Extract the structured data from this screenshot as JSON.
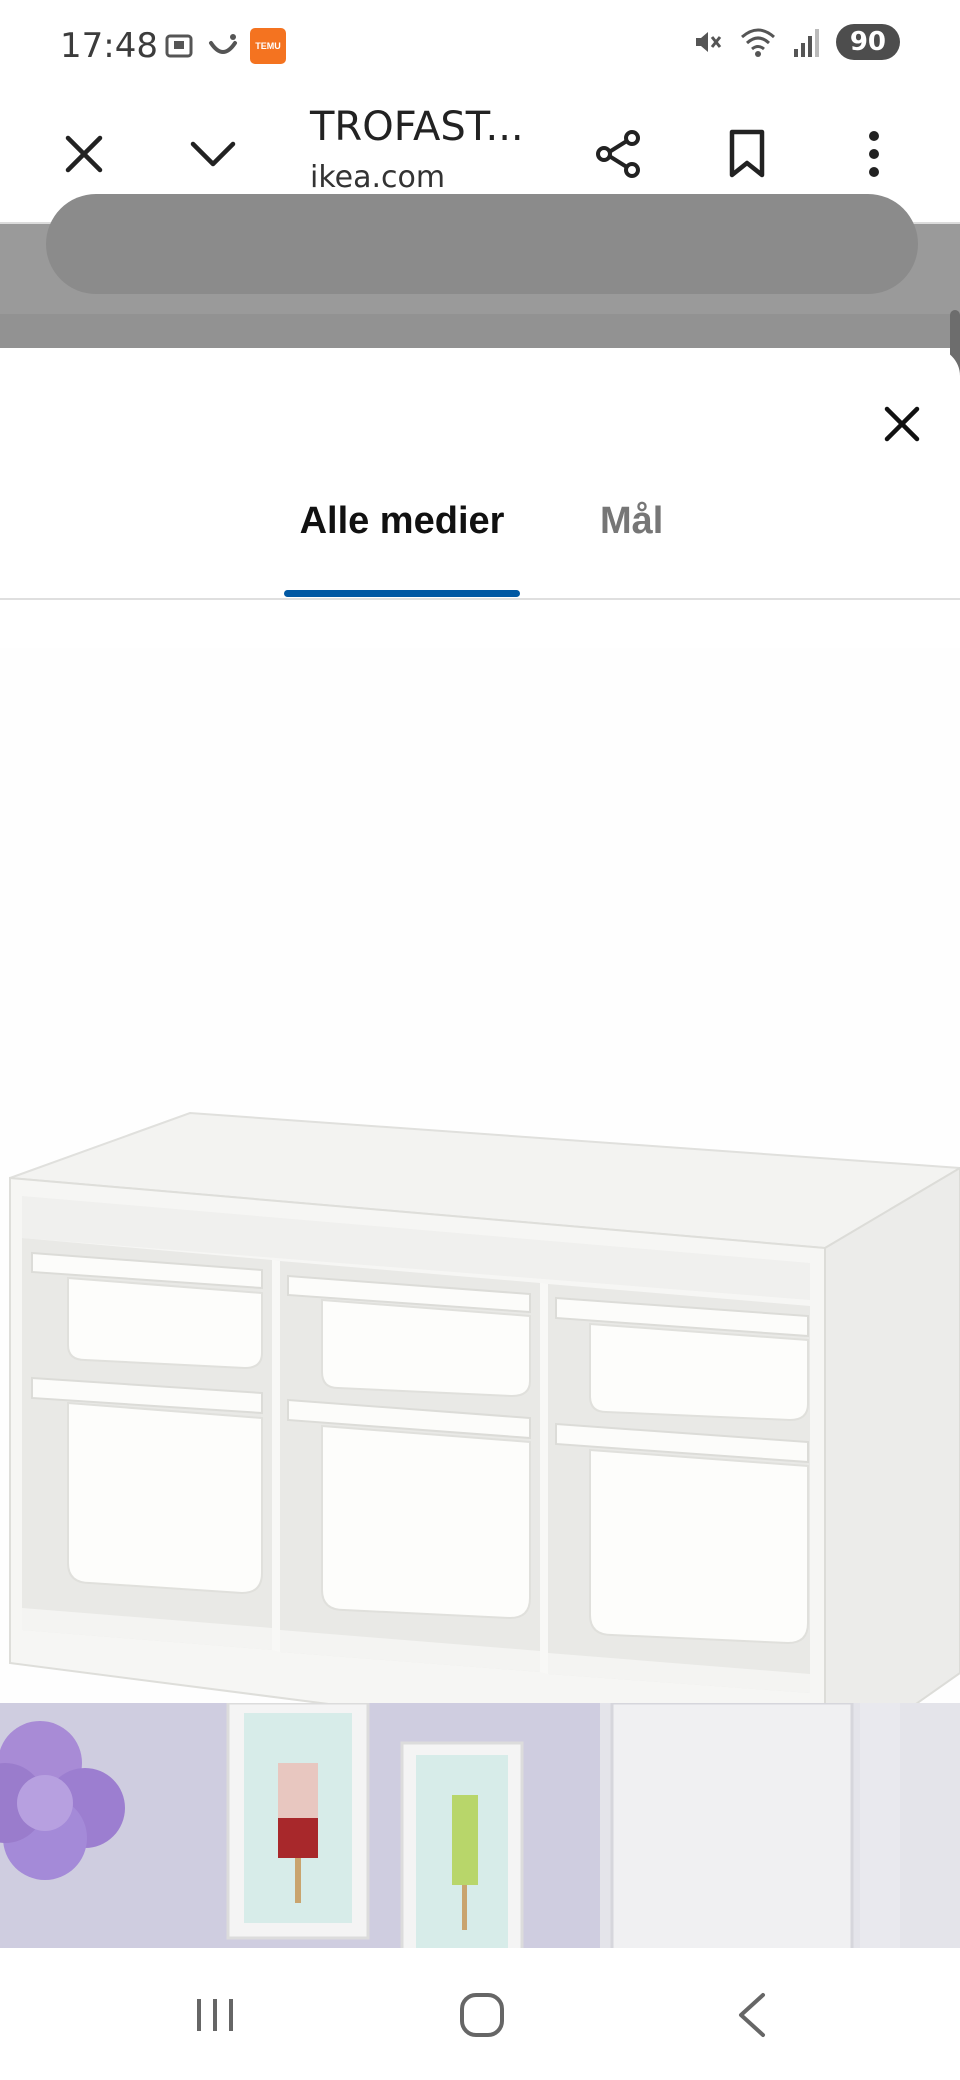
{
  "status_bar": {
    "time": "17:48",
    "temu_label": "TEMU",
    "battery": "90"
  },
  "toolbar": {
    "title": "TROFAST...",
    "url": "ikea.com"
  },
  "sheet": {
    "tabs": [
      {
        "label": "Alle medier",
        "active": true
      },
      {
        "label": "Mål",
        "active": false
      }
    ],
    "accent_color": "#0058a3"
  },
  "icons": {
    "toolbar": [
      "close-icon",
      "chevron-down-icon",
      "share-icon",
      "bookmark-icon",
      "more-vert-icon"
    ],
    "nav": [
      "recent-apps-icon",
      "home-icon",
      "back-icon"
    ]
  }
}
